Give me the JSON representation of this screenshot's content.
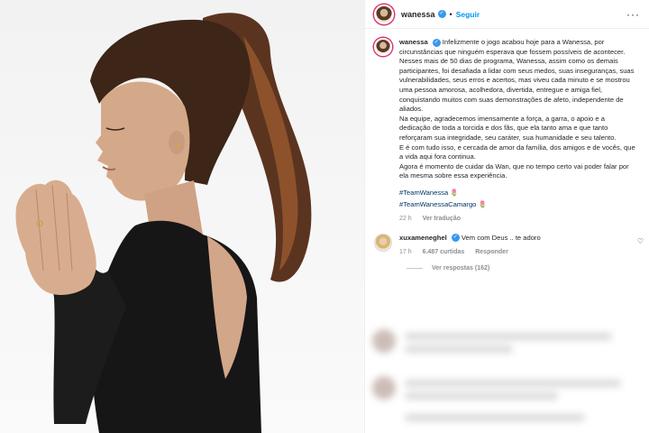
{
  "post": {
    "username": "wanessa",
    "follow_label": "Seguir",
    "more_icon": "ellipsis-icon",
    "caption": {
      "username": "wanessa",
      "lines": [
        "Infelizmente o jogo acabou hoje para a Wanessa, por circunstâncias que ninguém esperava que fossem possíveis de acontecer.",
        "Nesses mais de 50 dias de programa, Wanessa, assim como os demais participantes, foi desafiada a lidar com seus medos, suas inseguranças, suas vulnerabilidades, seus erros e acertos, mas viveu cada minuto e se mostrou uma pessoa amorosa, acolhedora, divertida, entregue e amiga fiel, conquistando muitos com suas demonstrações de afeto, independente de aliados.",
        "Na equipe, agradecemos imensamente a força, a garra, o apoio e a dedicação de toda a torcida e dos fãs, que ela tanto ama e que tanto reforçaram sua integridade, seu caráter, sua humanidade e seu talento.",
        "E é com tudo isso, e cercada de amor da família, dos amigos e de vocês, que a vida aqui fora continua.",
        "Agora é momento de cuidar da Wan, que no tempo certo vai poder falar por ela mesma sobre essa experiência."
      ],
      "hashtags": [
        "#TeamWanessa 🌷",
        "#TeamWanessaCamargo 🌷"
      ],
      "time": "22 h",
      "translate": "Ver tradução"
    },
    "comment": {
      "username": "xuxameneghel",
      "text": "Vem com Deus .. te adoro",
      "time": "17 h",
      "likes": "6.487 curtidas",
      "reply": "Responder",
      "view_replies": "Ver respostas (162)"
    },
    "colors": {
      "link": "#0095f6",
      "hashtag": "#00376b",
      "verified": "#3897f0"
    }
  }
}
